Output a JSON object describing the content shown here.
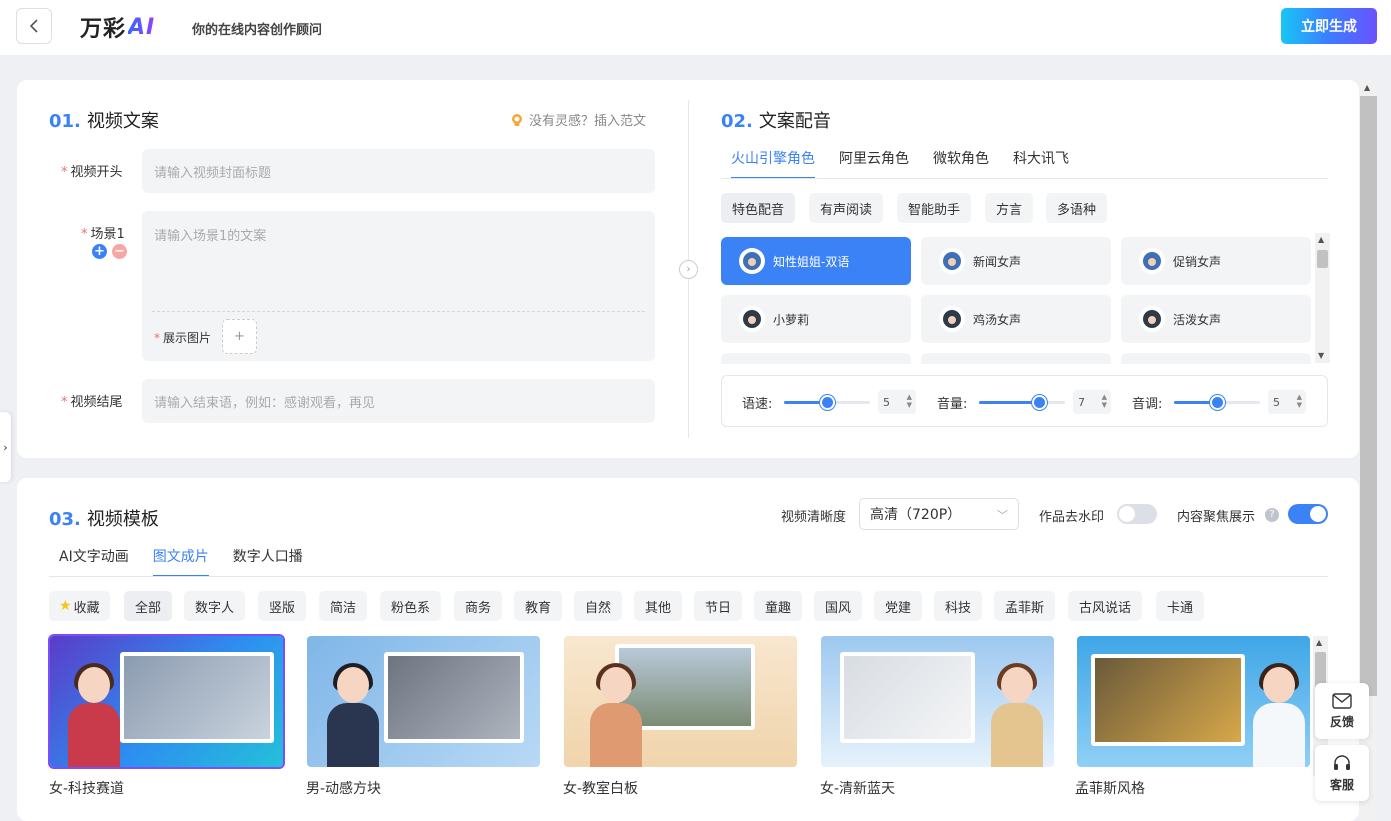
{
  "header": {
    "logo_text": "万彩",
    "logo_ai": "AI",
    "slogan": "你的在线内容创作顾问",
    "generate_label": "立即生成"
  },
  "script_section": {
    "num": "01.",
    "title": "视频文案",
    "inspire_text": "没有灵感？插入范文",
    "opening_label": "视频开头",
    "opening_placeholder": "请输入视频封面标题",
    "scene_label": "场景1",
    "scene_placeholder": "请输入场景1的文案",
    "image_label": "展示图片",
    "image_add": "+",
    "ending_label": "视频结尾",
    "ending_placeholder": "请输入结束语，例如：感谢观看，再见"
  },
  "voice_section": {
    "num": "02.",
    "title": "文案配音",
    "providers": [
      "火山引擎角色",
      "阿里云角色",
      "微软角色",
      "科大讯飞"
    ],
    "categories": [
      "特色配音",
      "有声阅读",
      "智能助手",
      "方言",
      "多语种"
    ],
    "voices": [
      "知性姐姐-双语",
      "新闻女声",
      "促销女声",
      "小萝莉",
      "鸡汤女声",
      "活泼女声"
    ],
    "speed_label": "语速:",
    "speed_value": "5",
    "speed_level": 0.5,
    "volume_label": "音量:",
    "volume_value": "7",
    "volume_level": 0.7,
    "pitch_label": "音调:",
    "pitch_value": "5",
    "pitch_level": 0.5
  },
  "template_section": {
    "num": "03.",
    "title": "视频模板",
    "clarity_label": "视频清晰度",
    "clarity_value": "高清（720P）",
    "watermark_label": "作品去水印",
    "watermark_on": false,
    "focus_label": "内容聚焦展示",
    "focus_on": true,
    "help": "?",
    "tabs": [
      "AI文字动画",
      "图文成片",
      "数字人口播"
    ],
    "categories": [
      "收藏",
      "全部",
      "数字人",
      "竖版",
      "简洁",
      "粉色系",
      "商务",
      "教育",
      "自然",
      "其他",
      "节日",
      "童趣",
      "国风",
      "党建",
      "科技",
      "孟菲斯",
      "古风说话",
      "卡通"
    ],
    "templates": [
      "女-科技赛道",
      "男-动感方块",
      "女-教室白板",
      "女-清新蓝天",
      "孟菲斯风格"
    ]
  },
  "side": {
    "feedback_label": "反馈",
    "service_label": "客服"
  },
  "colors": {
    "accent": "#3b82f6",
    "required": "#f56c6c"
  }
}
